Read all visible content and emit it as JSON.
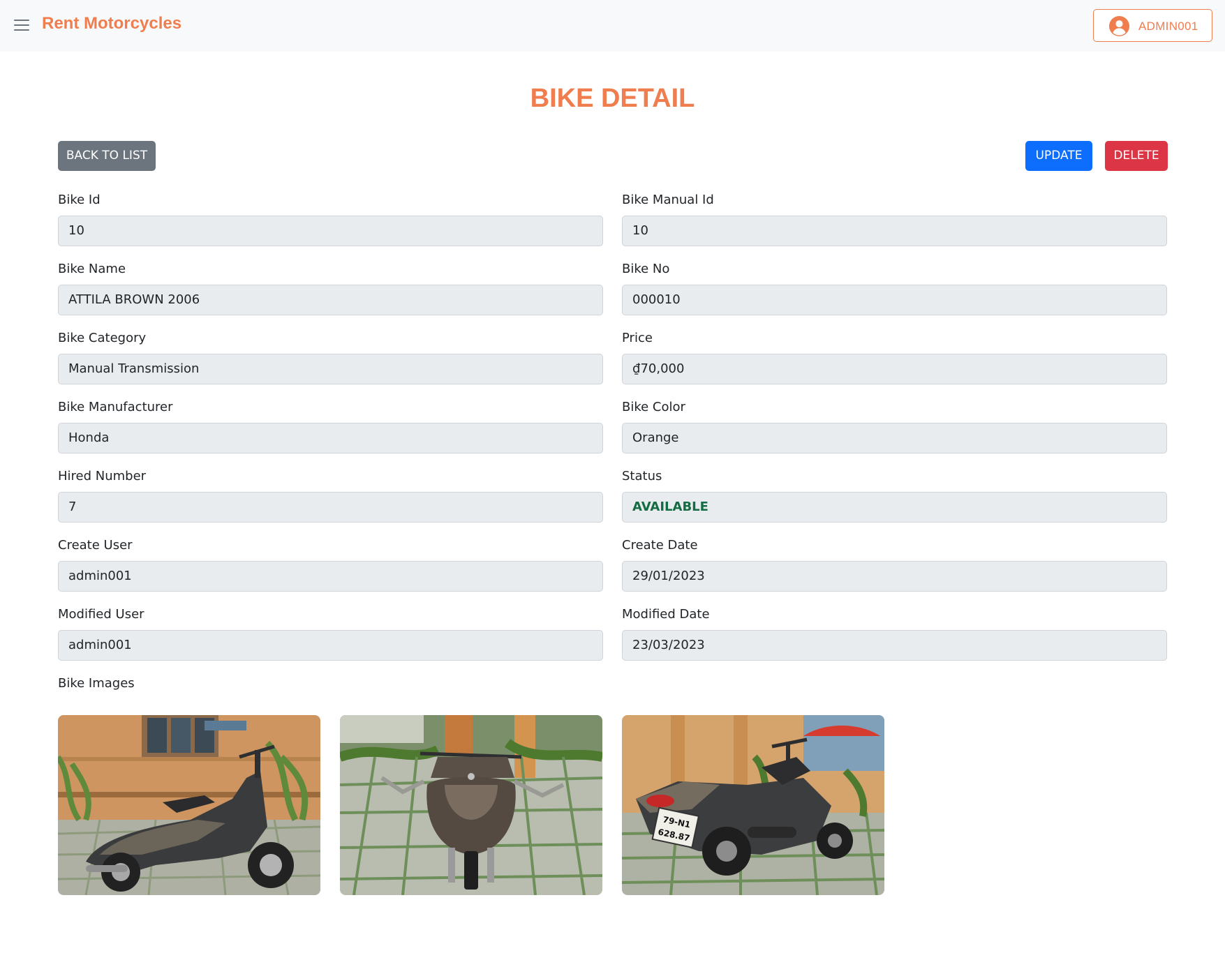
{
  "header": {
    "brand": "Rent Motorcycles",
    "user_label": "ADMIN001"
  },
  "page": {
    "title": "BIKE DETAIL"
  },
  "actions": {
    "back_label": "BACK TO LIST",
    "update_label": "UPDATE",
    "delete_label": "DELETE"
  },
  "fields": {
    "bike_id": {
      "label": "Bike Id",
      "value": "10"
    },
    "bike_manual_id": {
      "label": "Bike Manual Id",
      "value": "10"
    },
    "bike_name": {
      "label": "Bike Name",
      "value": "ATTILA BROWN 2006"
    },
    "bike_no": {
      "label": "Bike No",
      "value": "000010"
    },
    "bike_category": {
      "label": "Bike Category",
      "value": "Manual Transmission"
    },
    "price": {
      "label": "Price",
      "value": "₫70,000"
    },
    "bike_manufacturer": {
      "label": "Bike Manufacturer",
      "value": "Honda"
    },
    "bike_color": {
      "label": "Bike Color",
      "value": "Orange"
    },
    "hired_number": {
      "label": "Hired Number",
      "value": "7"
    },
    "status": {
      "label": "Status",
      "value": "AVAILABLE"
    },
    "create_user": {
      "label": "Create User",
      "value": "admin001"
    },
    "create_date": {
      "label": "Create Date",
      "value": "29/01/2023"
    },
    "modified_user": {
      "label": "Modified User",
      "value": "admin001"
    },
    "modified_date": {
      "label": "Modified Date",
      "value": "23/03/2023"
    }
  },
  "images": {
    "label": "Bike Images",
    "plate_text_1": "79-N1",
    "plate_text_2": "628.87"
  },
  "colors": {
    "brand": "#ef7d4e",
    "primary": "#0d6efd",
    "danger": "#dc3545",
    "secondary": "#6c757d",
    "success_text": "#146c43"
  }
}
